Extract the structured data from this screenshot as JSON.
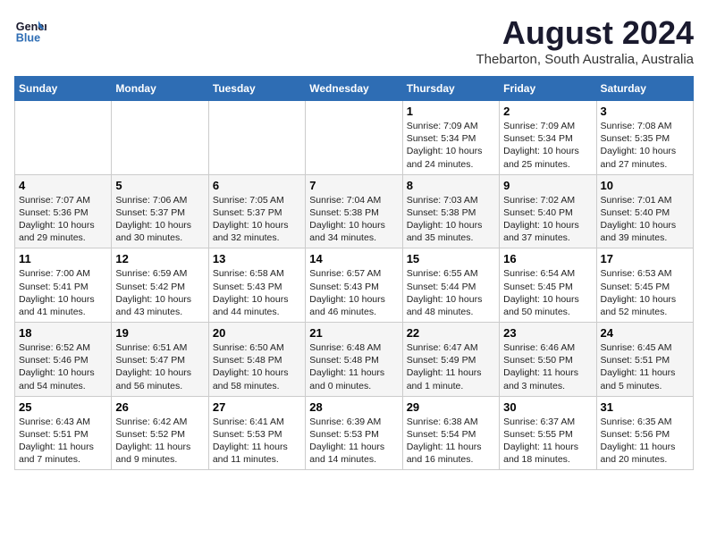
{
  "header": {
    "logo_line1": "General",
    "logo_line2": "Blue",
    "title": "August 2024",
    "subtitle": "Thebarton, South Australia, Australia"
  },
  "days_of_week": [
    "Sunday",
    "Monday",
    "Tuesday",
    "Wednesday",
    "Thursday",
    "Friday",
    "Saturday"
  ],
  "weeks": [
    [
      {
        "num": "",
        "info": ""
      },
      {
        "num": "",
        "info": ""
      },
      {
        "num": "",
        "info": ""
      },
      {
        "num": "",
        "info": ""
      },
      {
        "num": "1",
        "info": "Sunrise: 7:09 AM\nSunset: 5:34 PM\nDaylight: 10 hours\nand 24 minutes."
      },
      {
        "num": "2",
        "info": "Sunrise: 7:09 AM\nSunset: 5:34 PM\nDaylight: 10 hours\nand 25 minutes."
      },
      {
        "num": "3",
        "info": "Sunrise: 7:08 AM\nSunset: 5:35 PM\nDaylight: 10 hours\nand 27 minutes."
      }
    ],
    [
      {
        "num": "4",
        "info": "Sunrise: 7:07 AM\nSunset: 5:36 PM\nDaylight: 10 hours\nand 29 minutes."
      },
      {
        "num": "5",
        "info": "Sunrise: 7:06 AM\nSunset: 5:37 PM\nDaylight: 10 hours\nand 30 minutes."
      },
      {
        "num": "6",
        "info": "Sunrise: 7:05 AM\nSunset: 5:37 PM\nDaylight: 10 hours\nand 32 minutes."
      },
      {
        "num": "7",
        "info": "Sunrise: 7:04 AM\nSunset: 5:38 PM\nDaylight: 10 hours\nand 34 minutes."
      },
      {
        "num": "8",
        "info": "Sunrise: 7:03 AM\nSunset: 5:38 PM\nDaylight: 10 hours\nand 35 minutes."
      },
      {
        "num": "9",
        "info": "Sunrise: 7:02 AM\nSunset: 5:40 PM\nDaylight: 10 hours\nand 37 minutes."
      },
      {
        "num": "10",
        "info": "Sunrise: 7:01 AM\nSunset: 5:40 PM\nDaylight: 10 hours\nand 39 minutes."
      }
    ],
    [
      {
        "num": "11",
        "info": "Sunrise: 7:00 AM\nSunset: 5:41 PM\nDaylight: 10 hours\nand 41 minutes."
      },
      {
        "num": "12",
        "info": "Sunrise: 6:59 AM\nSunset: 5:42 PM\nDaylight: 10 hours\nand 43 minutes."
      },
      {
        "num": "13",
        "info": "Sunrise: 6:58 AM\nSunset: 5:43 PM\nDaylight: 10 hours\nand 44 minutes."
      },
      {
        "num": "14",
        "info": "Sunrise: 6:57 AM\nSunset: 5:43 PM\nDaylight: 10 hours\nand 46 minutes."
      },
      {
        "num": "15",
        "info": "Sunrise: 6:55 AM\nSunset: 5:44 PM\nDaylight: 10 hours\nand 48 minutes."
      },
      {
        "num": "16",
        "info": "Sunrise: 6:54 AM\nSunset: 5:45 PM\nDaylight: 10 hours\nand 50 minutes."
      },
      {
        "num": "17",
        "info": "Sunrise: 6:53 AM\nSunset: 5:45 PM\nDaylight: 10 hours\nand 52 minutes."
      }
    ],
    [
      {
        "num": "18",
        "info": "Sunrise: 6:52 AM\nSunset: 5:46 PM\nDaylight: 10 hours\nand 54 minutes."
      },
      {
        "num": "19",
        "info": "Sunrise: 6:51 AM\nSunset: 5:47 PM\nDaylight: 10 hours\nand 56 minutes."
      },
      {
        "num": "20",
        "info": "Sunrise: 6:50 AM\nSunset: 5:48 PM\nDaylight: 10 hours\nand 58 minutes."
      },
      {
        "num": "21",
        "info": "Sunrise: 6:48 AM\nSunset: 5:48 PM\nDaylight: 11 hours\nand 0 minutes."
      },
      {
        "num": "22",
        "info": "Sunrise: 6:47 AM\nSunset: 5:49 PM\nDaylight: 11 hours\nand 1 minute."
      },
      {
        "num": "23",
        "info": "Sunrise: 6:46 AM\nSunset: 5:50 PM\nDaylight: 11 hours\nand 3 minutes."
      },
      {
        "num": "24",
        "info": "Sunrise: 6:45 AM\nSunset: 5:51 PM\nDaylight: 11 hours\nand 5 minutes."
      }
    ],
    [
      {
        "num": "25",
        "info": "Sunrise: 6:43 AM\nSunset: 5:51 PM\nDaylight: 11 hours\nand 7 minutes."
      },
      {
        "num": "26",
        "info": "Sunrise: 6:42 AM\nSunset: 5:52 PM\nDaylight: 11 hours\nand 9 minutes."
      },
      {
        "num": "27",
        "info": "Sunrise: 6:41 AM\nSunset: 5:53 PM\nDaylight: 11 hours\nand 11 minutes."
      },
      {
        "num": "28",
        "info": "Sunrise: 6:39 AM\nSunset: 5:53 PM\nDaylight: 11 hours\nand 14 minutes."
      },
      {
        "num": "29",
        "info": "Sunrise: 6:38 AM\nSunset: 5:54 PM\nDaylight: 11 hours\nand 16 minutes."
      },
      {
        "num": "30",
        "info": "Sunrise: 6:37 AM\nSunset: 5:55 PM\nDaylight: 11 hours\nand 18 minutes."
      },
      {
        "num": "31",
        "info": "Sunrise: 6:35 AM\nSunset: 5:56 PM\nDaylight: 11 hours\nand 20 minutes."
      }
    ]
  ]
}
